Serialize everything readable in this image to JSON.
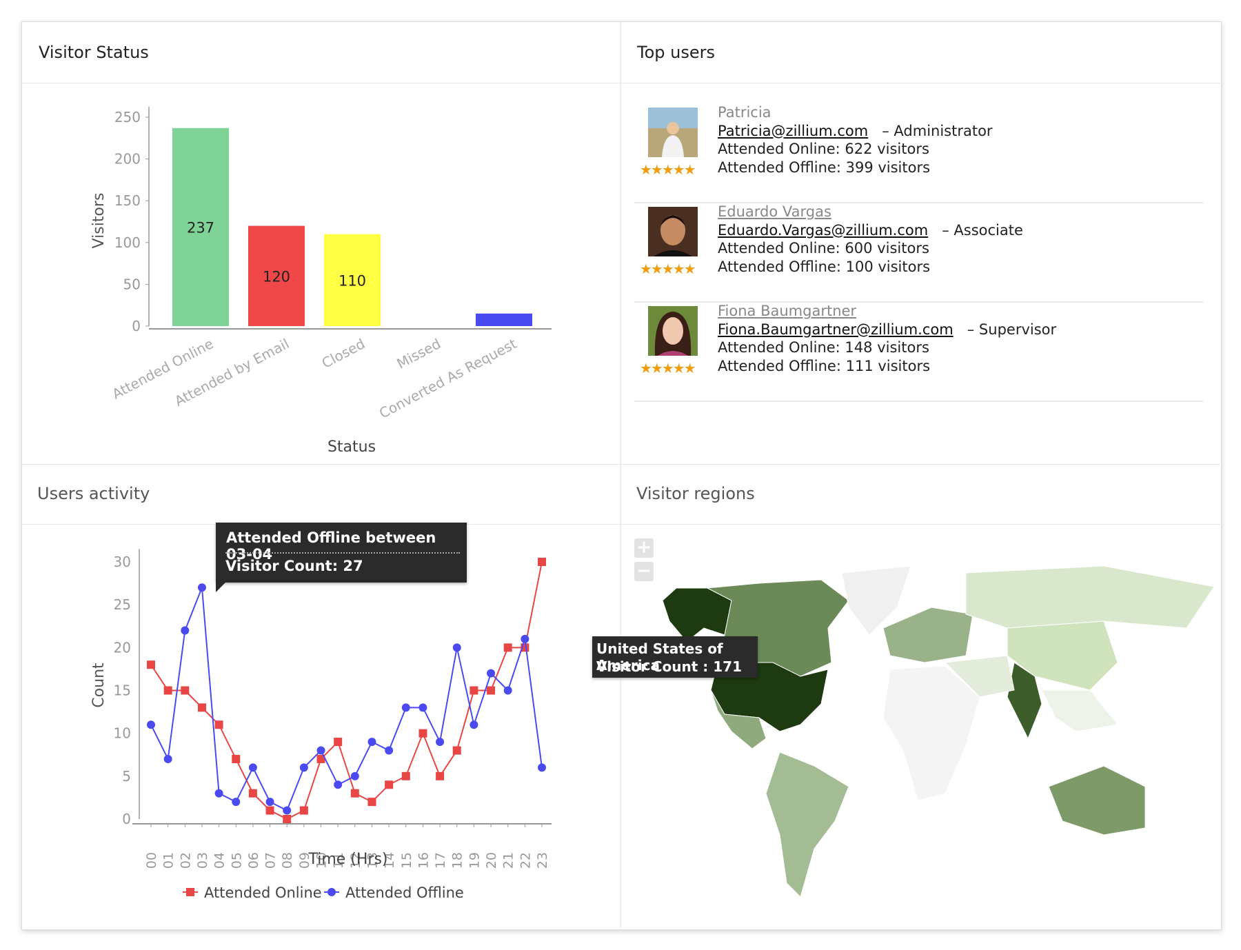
{
  "panels": {
    "visitor_status": "Visitor Status",
    "top_users": "Top users",
    "users_activity": "Users activity",
    "visitor_regions": "Visitor regions"
  },
  "chart_data": [
    {
      "type": "bar",
      "title": "Visitor Status",
      "xlabel": "Status",
      "ylabel": "Visitors",
      "ylim": [
        0,
        250
      ],
      "yticks": [
        "0",
        "50",
        "100",
        "150",
        "200",
        "250"
      ],
      "categories": [
        "Attended Online",
        "Attended by Email",
        "Closed",
        "Missed",
        "Converted As Request"
      ],
      "values": [
        237,
        120,
        110,
        0,
        15
      ],
      "labels": [
        "237",
        "120",
        "110",
        "",
        ""
      ],
      "colors": [
        "#7fd396",
        "#f04848",
        "#ffff44",
        "#5050f0",
        "#4a4af0"
      ]
    },
    {
      "type": "line",
      "title": "Users activity",
      "xlabel": "Time (Hrs)",
      "ylabel": "Count",
      "ylim": [
        0,
        30
      ],
      "yticks": [
        "0",
        "5",
        "10",
        "15",
        "20",
        "25",
        "30"
      ],
      "x": [
        "00",
        "01",
        "02",
        "03",
        "04",
        "05",
        "06",
        "07",
        "08",
        "09",
        "10",
        "11",
        "12",
        "13",
        "14",
        "15",
        "16",
        "17",
        "18",
        "19",
        "20",
        "21",
        "22",
        "23"
      ],
      "series": [
        {
          "name": "Attended Online",
          "color": "#e84545",
          "marker": "square",
          "values": [
            18,
            15,
            15,
            13,
            11,
            7,
            3,
            1,
            0,
            1,
            7,
            9,
            3,
            2,
            4,
            5,
            10,
            5,
            8,
            15,
            15,
            20,
            20,
            30
          ]
        },
        {
          "name": "Attended Offline",
          "color": "#4a4af0",
          "marker": "circle",
          "values": [
            11,
            7,
            22,
            27,
            3,
            2,
            6,
            2,
            1,
            6,
            8,
            4,
            5,
            9,
            8,
            13,
            13,
            9,
            20,
            11,
            17,
            15,
            21,
            6
          ]
        }
      ],
      "legend": "bottom",
      "tooltip": {
        "title": "Attended Offline between 03-04",
        "label": "Visitor Count:",
        "value": "27"
      }
    }
  ],
  "top_users": [
    {
      "name": "Patricia",
      "email": "Patricia@zillium.com",
      "role": "– Administrator",
      "online": "Attended Online: 622 visitors",
      "offline": "Attended Offline: 399 visitors",
      "stars": "★★★★★",
      "rating": 5
    },
    {
      "name": "Eduardo Vargas",
      "email": "Eduardo.Vargas@zillium.com",
      "role": "– Associate",
      "online": "Attended Online: 600 visitors",
      "offline": "Attended Offline: 100 visitors",
      "stars": "★★★★★",
      "rating": 5
    },
    {
      "name": "Fiona Baumgartner",
      "email": "Fiona.Baumgartner@zillium.com",
      "role": "– Supervisor",
      "online": "Attended Online: 148 visitors",
      "offline": "Attended Offline: 111 visitors",
      "stars": "★★★★★",
      "rating": 5
    }
  ],
  "map": {
    "zoom_in": "+",
    "zoom_out": "−",
    "tooltip_country": "United States of America",
    "tooltip_count": "Visitor Count : 171"
  }
}
